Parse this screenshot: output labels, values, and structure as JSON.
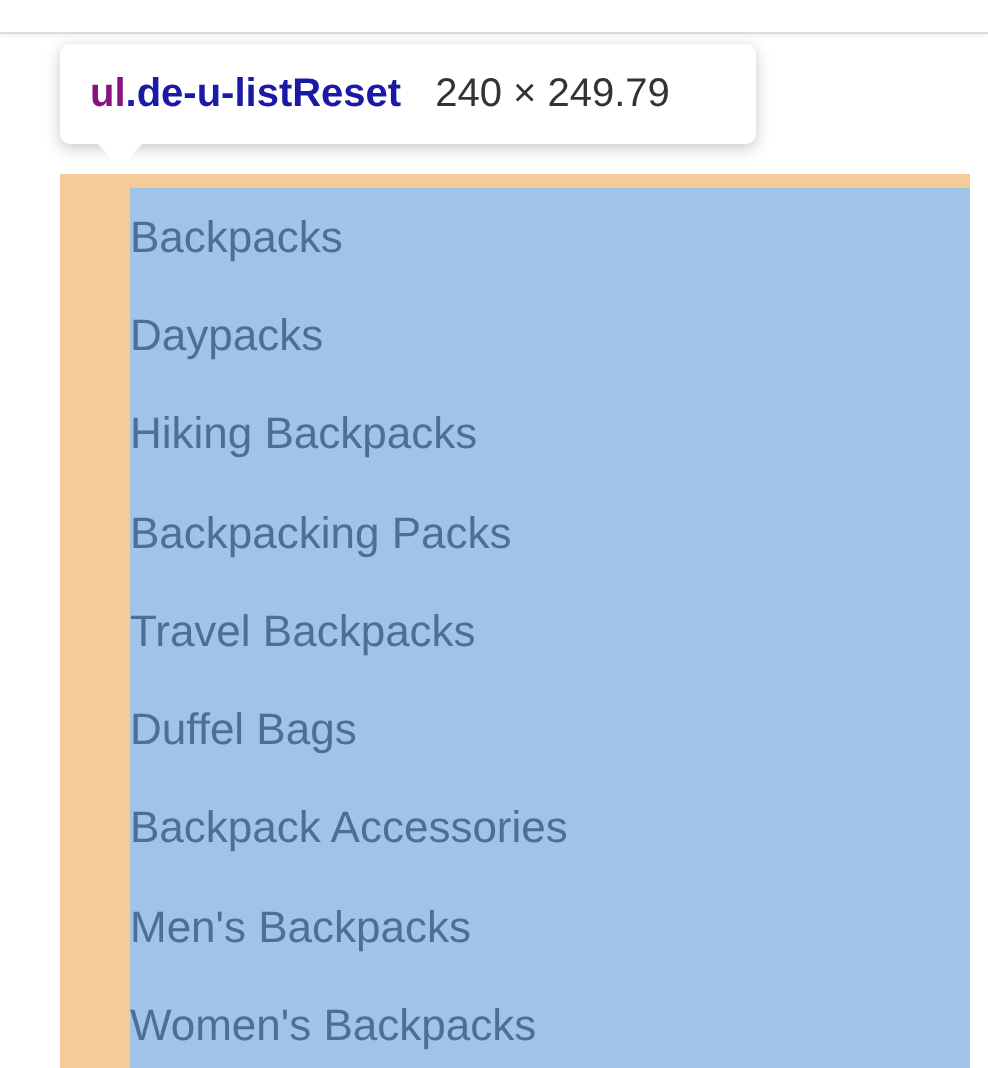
{
  "tooltip": {
    "tag": "ul",
    "selector": ".de-u-listReset",
    "size": "240 × 249.79"
  },
  "list_items": [
    "Backpacks",
    "Daypacks",
    "Hiking Backpacks",
    "Backpacking Packs",
    "Travel Backpacks",
    "Duffel Bags",
    "Backpack Accessories",
    "Men's Backpacks",
    "Women's Backpacks"
  ]
}
